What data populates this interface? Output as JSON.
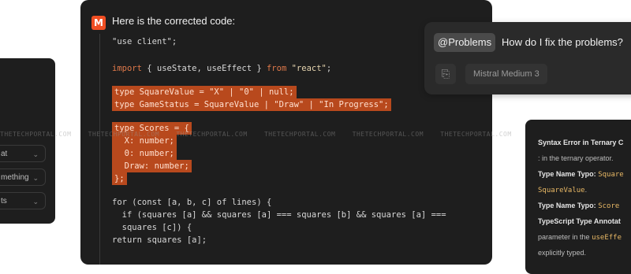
{
  "left_panel": {
    "items": [
      {
        "label": "at"
      },
      {
        "label": "mething"
      },
      {
        "label": "ts"
      }
    ]
  },
  "main": {
    "logo_text": "M",
    "intro": "Here is the corrected code:",
    "code_lines": [
      "\"use client\";",
      "",
      "import { useState, useEffect } from \"react\";",
      "",
      "type SquareValue = \"X\" | \"0\" | null;",
      "type GameStatus = SquareValue | \"Draw\" | \"In Progress\";",
      "",
      "type Scores = {",
      "  X: number;",
      "  0: number;",
      "  Draw: number;",
      "};",
      "",
      "for (const [a, b, c] of lines) {",
      "  if (squares [a] && squares [a] === squares [b] && squares [a] ===",
      "  squares [c]) {",
      "return squares [a];"
    ]
  },
  "chat": {
    "mention": "@Problems",
    "question": "How do I fix the problems?",
    "model": "Mistral Medium 3",
    "attach_icon": "paperclip-icon"
  },
  "errors": {
    "line1": "Syntax Error in Ternary C",
    "line2": ": in the ternary operator.",
    "line3_title": "Type Name Typo:",
    "line3_code": "Square",
    "line4_code": "SquareValue",
    "line4_rest": ".",
    "line5_title": "Type Name Typo:",
    "line5_code": "Score",
    "line6_title": "TypeScript Type Annotat",
    "line7_a": "parameter in the",
    "line7_code": "useEffe",
    "line8": "explicitly typed."
  },
  "watermark": "THETECHPORTAL.COM"
}
